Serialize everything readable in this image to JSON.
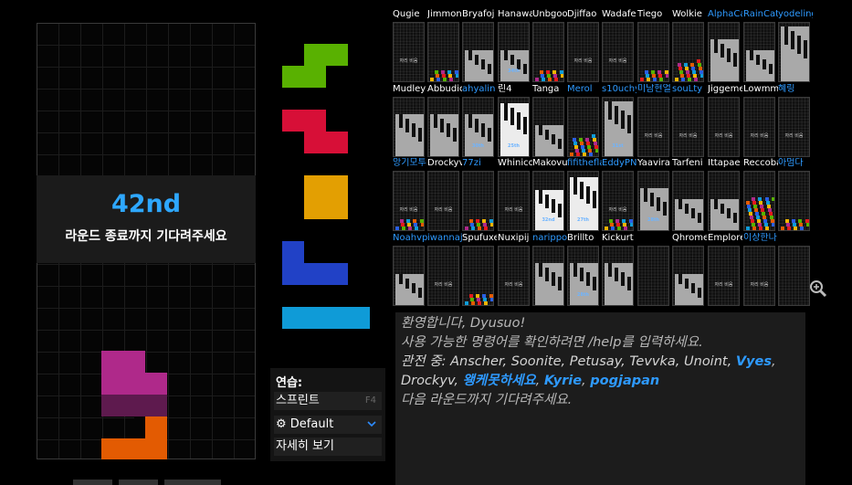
{
  "status": {
    "placement": "42nd",
    "message": "라운드 종료까지 기다려주세요"
  },
  "next_queue": [
    {
      "piece": "S",
      "color": "#59b101"
    },
    {
      "piece": "Z",
      "color": "#d70f37"
    },
    {
      "piece": "O",
      "color": "#e39f02"
    },
    {
      "piece": "J",
      "color": "#2141c6"
    },
    {
      "piece": "I",
      "color": "#0f9bd7"
    }
  ],
  "board": {
    "active_piece_colors": [
      "#af298a",
      "#5e1a4e",
      "#e35b02"
    ]
  },
  "practice_menu": {
    "label": "연습:",
    "sprint_label": "스프린트",
    "sprint_key": "F4",
    "mode_label": "Default",
    "details_label": "자세히 보기"
  },
  "chat": {
    "welcome": "환영합니다, Dyusuo!",
    "help_line": "사용 가능한 명령어를 확인하려면 /help를 입력하세요.",
    "spectators_prefix": "관전 중: Anscher, Soonite, Petusay, Tevvka, Unoint,",
    "spectator_highlight_1": "Vyes",
    "spectators_line2_prefix": "Drockyv,",
    "spectator_highlight_2": "왱케못하세요",
    "spectator_highlight_3": "Kyrie",
    "spectator_highlight_4": "pogjapan",
    "wait_line": "다음 라운드까지 기다려주세요."
  },
  "opponent_status": {
    "empty_seat": "자리 비움"
  },
  "opponents": [
    [
      {
        "name": "Qugie",
        "hl": false,
        "stack": "none",
        "empty": true
      },
      {
        "name": "Jimmon",
        "hl": false,
        "stack": "colorful-low",
        "empty": false
      },
      {
        "name": "Bryafoj",
        "hl": false,
        "stack": "gray-mid",
        "empty": false
      },
      {
        "name": "Hanawa",
        "hl": false,
        "stack": "gray-mid",
        "empty": false,
        "rank": "34th"
      },
      {
        "name": "Unbgoo",
        "hl": false,
        "stack": "colorful-low",
        "empty": false
      },
      {
        "name": "Djiffao",
        "hl": false,
        "stack": "none",
        "empty": true
      },
      {
        "name": "Wadafe",
        "hl": false,
        "stack": "none",
        "empty": true
      },
      {
        "name": "Tiego",
        "hl": false,
        "stack": "colorful-low",
        "empty": false
      },
      {
        "name": "Wolkie",
        "hl": false,
        "stack": "colorful-mid",
        "empty": false
      },
      {
        "name": "AlphaCa",
        "hl": true,
        "stack": "gray-high",
        "empty": false
      },
      {
        "name": "RainCat",
        "hl": true,
        "stack": "gray-mid",
        "empty": false
      },
      {
        "name": "yodeling",
        "hl": true,
        "stack": "gray-full",
        "empty": false
      }
    ],
    [
      {
        "name": "Mudley",
        "hl": false,
        "stack": "gray-high",
        "empty": false
      },
      {
        "name": "Abbudic",
        "hl": false,
        "stack": "gray-high",
        "empty": false
      },
      {
        "name": "ahyalin",
        "hl": true,
        "stack": "gray-high",
        "empty": false,
        "rank": "30th"
      },
      {
        "name": "린4",
        "hl": false,
        "stack": "white-full",
        "empty": false,
        "rank": "25th"
      },
      {
        "name": "Tanga",
        "hl": false,
        "stack": "gray-mid",
        "empty": false
      },
      {
        "name": "Merol",
        "hl": true,
        "stack": "colorful-mid",
        "empty": false
      },
      {
        "name": "s10uchy",
        "hl": true,
        "stack": "gray-full",
        "empty": false,
        "rank": "31st"
      },
      {
        "name": "미남현얼",
        "hl": true,
        "stack": "none",
        "empty": true
      },
      {
        "name": "souLty",
        "hl": true,
        "stack": "none",
        "empty": true
      },
      {
        "name": "Jiggeme",
        "hl": false,
        "stack": "none",
        "empty": true
      },
      {
        "name": "Lowmm",
        "hl": false,
        "stack": "none",
        "empty": true
      },
      {
        "name": "혜링",
        "hl": true,
        "stack": "none",
        "empty": true
      }
    ],
    [
      {
        "name": "앙기모투",
        "hl": true,
        "stack": "colorful-low",
        "empty": true
      },
      {
        "name": "Drockyv",
        "hl": false,
        "stack": "none",
        "empty": true
      },
      {
        "name": "77zi",
        "hl": true,
        "stack": "colorful-low",
        "empty": false
      },
      {
        "name": "Whinico",
        "hl": false,
        "stack": "none",
        "empty": true
      },
      {
        "name": "Makovu",
        "hl": false,
        "stack": "white-high",
        "empty": false,
        "rank": "32nd"
      },
      {
        "name": "fifithefla",
        "hl": true,
        "stack": "white-full",
        "empty": false,
        "rank": "27th"
      },
      {
        "name": "EddyPN",
        "hl": true,
        "stack": "colorful-low",
        "empty": true
      },
      {
        "name": "Yaavira",
        "hl": false,
        "stack": "gray-high",
        "empty": false,
        "rank": "28th"
      },
      {
        "name": "Tarfeni",
        "hl": false,
        "stack": "gray-mid",
        "empty": false
      },
      {
        "name": "Ittapae",
        "hl": false,
        "stack": "gray-mid",
        "empty": false
      },
      {
        "name": "Reccoba",
        "hl": false,
        "stack": "colorful-high",
        "empty": false
      },
      {
        "name": "아멈다",
        "hl": true,
        "stack": "colorful-low",
        "empty": false
      }
    ],
    [
      {
        "name": "Noahvp",
        "hl": true,
        "stack": "gray-mid",
        "empty": false
      },
      {
        "name": "iwannaj",
        "hl": true,
        "stack": "none",
        "empty": true
      },
      {
        "name": "Spufuxe",
        "hl": false,
        "stack": "colorful-low",
        "empty": false
      },
      {
        "name": "Nuxipij",
        "hl": false,
        "stack": "none",
        "empty": true
      },
      {
        "name": "narippo",
        "hl": true,
        "stack": "gray-high",
        "empty": false
      },
      {
        "name": "Brillto",
        "hl": false,
        "stack": "gray-high",
        "empty": false,
        "rank": "28th"
      },
      {
        "name": "Kickurt",
        "hl": false,
        "stack": "gray-high",
        "empty": false
      },
      {
        "name": "",
        "hl": false,
        "stack": "none",
        "empty": false
      },
      {
        "name": "Qhrome",
        "hl": false,
        "stack": "gray-mid",
        "empty": false
      },
      {
        "name": "Emplore",
        "hl": false,
        "stack": "none",
        "empty": true
      },
      {
        "name": "이상한나",
        "hl": true,
        "stack": "none",
        "empty": true
      },
      {
        "name": "",
        "hl": false,
        "stack": "none",
        "empty": false
      }
    ]
  ],
  "colors": {
    "accent": "#2e9aff",
    "panel": "#1c1c1c"
  }
}
